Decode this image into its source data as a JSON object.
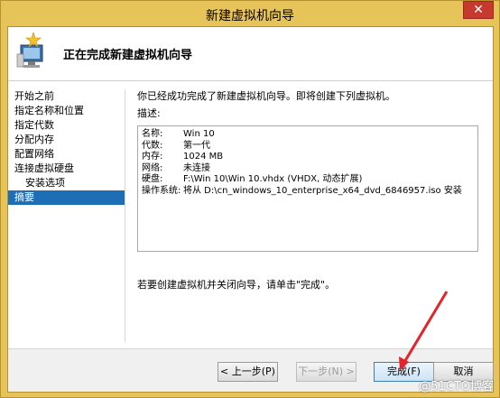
{
  "window": {
    "title": "新建虚拟机向导",
    "close_glyph": "✕"
  },
  "header": {
    "title": "正在完成新建虚拟机向导"
  },
  "nav": {
    "items": [
      {
        "label": "开始之前"
      },
      {
        "label": "指定名称和位置"
      },
      {
        "label": "指定代数"
      },
      {
        "label": "分配内存"
      },
      {
        "label": "配置网络"
      },
      {
        "label": "连接虚拟硬盘"
      },
      {
        "label": "安装选项"
      },
      {
        "label": "摘要"
      }
    ],
    "active": "摘要"
  },
  "content": {
    "intro": "你已经成功完成了新建虚拟机向导。即将创建下列虚拟机。",
    "desc_label": "描述:",
    "description": [
      {
        "key": "名称:",
        "value": "Win 10"
      },
      {
        "key": "代数:",
        "value": "第一代"
      },
      {
        "key": "内存:",
        "value": "1024 MB"
      },
      {
        "key": "网络:",
        "value": "未连接"
      },
      {
        "key": "硬盘:",
        "value": "F:\\Win 10\\Win 10.vhdx (VHDX, 动态扩展)"
      },
      {
        "key": "操作系统:",
        "value": "将从 D:\\cn_windows_10_enterprise_x64_dvd_6846957.iso 安装"
      }
    ],
    "finish_hint": "若要创建虚拟机并关闭向导，请单击\"完成\"。"
  },
  "footer": {
    "prev_label": "< 上一步(P)",
    "next_label": "下一步(N) >",
    "finish_label": "完成(F)",
    "cancel_label": "取消"
  },
  "watermark": "@51CTO博客",
  "colors": {
    "active_nav": "#1e6eb6",
    "arrow": "#e3242b",
    "title_bar": "#e7c45a"
  }
}
